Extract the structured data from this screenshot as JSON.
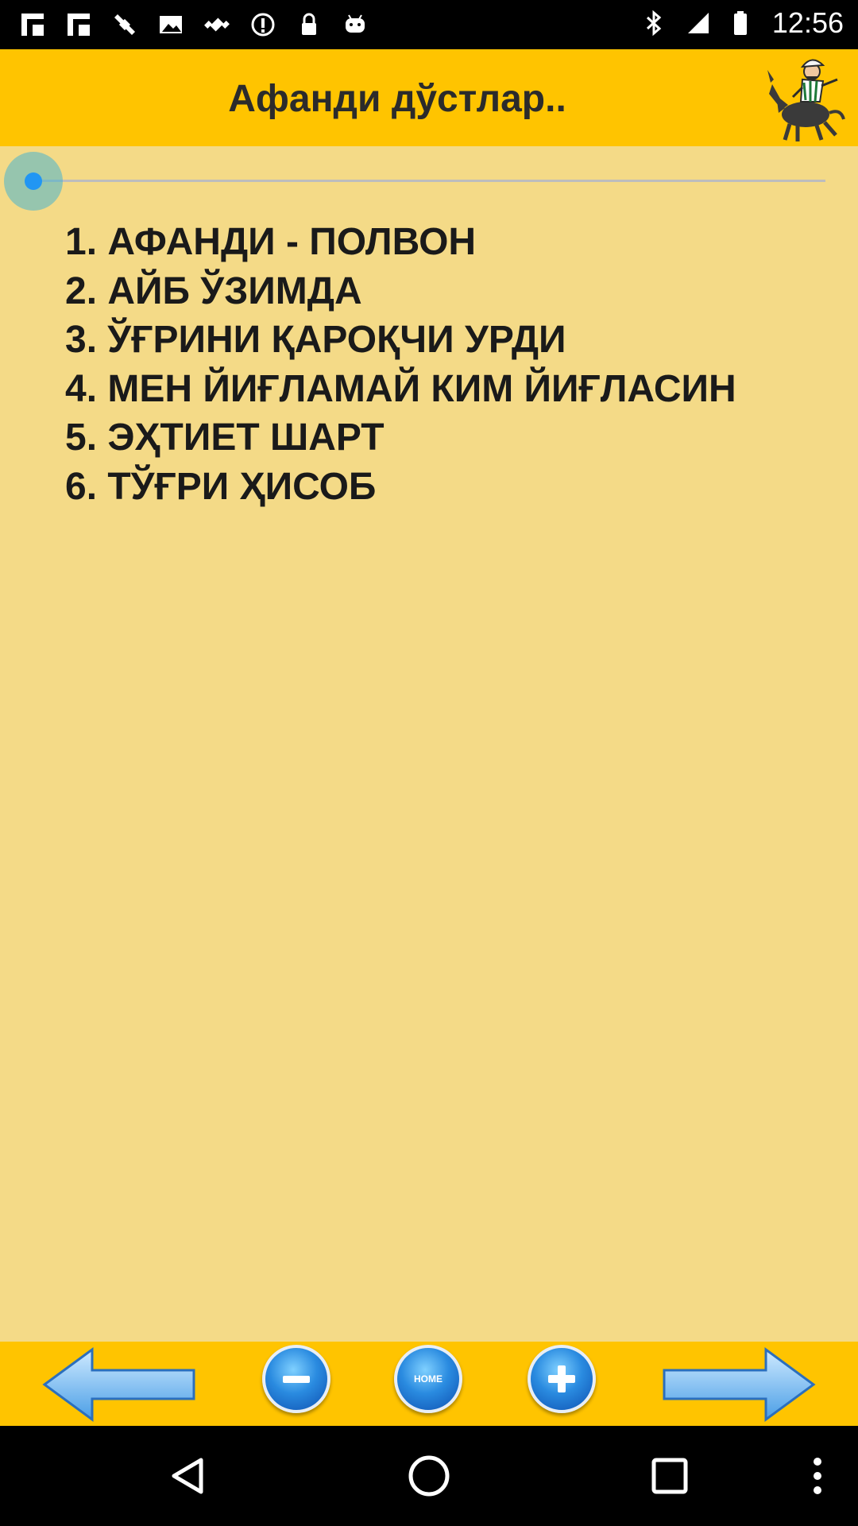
{
  "status_bar": {
    "time": "12:56",
    "left_icons": [
      "flipboard-icon",
      "flipboard-icon",
      "fake-gps-icon",
      "image-icon",
      "satellite-icon",
      "info-icon",
      "lock-icon",
      "android-icon"
    ],
    "right_icons": [
      "bluetooth-icon",
      "signal-icon",
      "battery-icon"
    ]
  },
  "header": {
    "title": "Афанди дўстлар..",
    "background": "#FFC400"
  },
  "content": {
    "background": "#F4DA87",
    "seekbar_progress": 0,
    "stories": [
      "1. АФАНДИ - ПОЛВОН",
      "2. АЙБ ЎЗИМДА",
      "3. ЎҒРИНИ ҚАРОҚЧИ УРДИ",
      "4. МЕН ЙИҒЛАМАЙ КИМ ЙИҒЛАСИН",
      "5. ЭҲТИЕТ ШАРТ",
      "6. ТЎҒРИ ҲИСОБ"
    ]
  },
  "toolbar": {
    "back_icon": "left-arrow-icon",
    "zoom_out_icon": "minus-icon",
    "home_label": "HOME",
    "zoom_in_icon": "plus-icon",
    "forward_icon": "right-arrow-icon"
  },
  "nav_bar": {
    "icons": [
      "back-triangle-icon",
      "home-circle-icon",
      "recents-square-icon",
      "overflow-menu-icon"
    ]
  }
}
